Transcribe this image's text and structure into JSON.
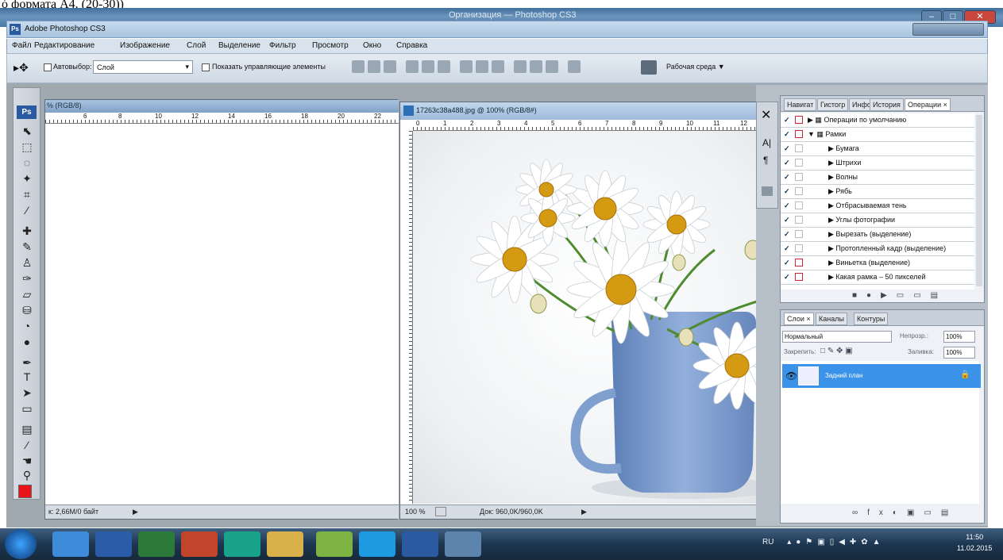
{
  "header": {
    "text": "ó формата А4. (20-30))"
  },
  "window": {
    "title": "Организация — Photoshop CS3"
  },
  "app": {
    "title": "Adobe Photoshop CS3",
    "logo": "Ps"
  },
  "menu": [
    "Файл",
    "Редактирование",
    "Изображение",
    "Слой",
    "Выделение",
    "Фильтр",
    "Просмотр",
    "Окно",
    "Справка"
  ],
  "options": {
    "autoselect_label": "Автовыбор:",
    "autoselect_value": "Слой",
    "show_controls_label": "Показать управляющие элементы",
    "workspace_label": "Рабочая среда ▼"
  },
  "doc1": {
    "title": "% (RGB/8)",
    "status": "к: 2,66М/0 байт",
    "ruler": [
      "6",
      "8",
      "10",
      "12",
      "14",
      "16",
      "18",
      "20",
      "22"
    ]
  },
  "doc2": {
    "title": "17263c38a488.jpg @ 100% (RGB/8#)",
    "zoom": "100 %",
    "status": "Док: 960,0K/960,0K",
    "ruler": [
      "0",
      "1",
      "2",
      "3",
      "4",
      "5",
      "6",
      "7",
      "8",
      "9",
      "10",
      "11",
      "12"
    ]
  },
  "actions_panel": {
    "tabs": [
      "Навигат",
      "Гистогр",
      "Инфо",
      "История",
      "Операции ×"
    ],
    "rows": [
      {
        "label": "Операции по умолчанию",
        "indent": 1,
        "square": true
      },
      {
        "label": "Рамки",
        "indent": 1,
        "square": true
      },
      {
        "label": "Бумага",
        "indent": 2,
        "square": false
      },
      {
        "label": "Штрихи",
        "indent": 2,
        "square": false
      },
      {
        "label": "Волны",
        "indent": 2,
        "square": false
      },
      {
        "label": "Рябь",
        "indent": 2,
        "square": false
      },
      {
        "label": "Отбрасываемая тень",
        "indent": 2,
        "square": false
      },
      {
        "label": "Углы фотографии",
        "indent": 2,
        "square": false
      },
      {
        "label": "Вырезать (выделение)",
        "indent": 2,
        "square": false
      },
      {
        "label": "Протопленный кадр (выделение)",
        "indent": 2,
        "square": false
      },
      {
        "label": "Виньетка (выделение)",
        "indent": 2,
        "square": true
      },
      {
        "label": "Какая рамка – 50 пикселей",
        "indent": 2,
        "square": true
      }
    ]
  },
  "layers_panel": {
    "tabs": [
      "Слои ×",
      "Каналы",
      "Контуры"
    ],
    "blend_mode": "Нормальный",
    "opacity_label": "Непрозр.:",
    "opacity_value": "100%",
    "lock_label": "Закрепить:",
    "fill_label": "Заливка:",
    "fill_value": "100%",
    "layer_name": "Задний план"
  },
  "taskbar": {
    "lang": "RU",
    "time": "11:50",
    "date": "11.02.2015"
  },
  "colors": {
    "foreground": "#e8141a",
    "layer_selected": "#3a93e8",
    "accent": "#2c5aa0"
  }
}
